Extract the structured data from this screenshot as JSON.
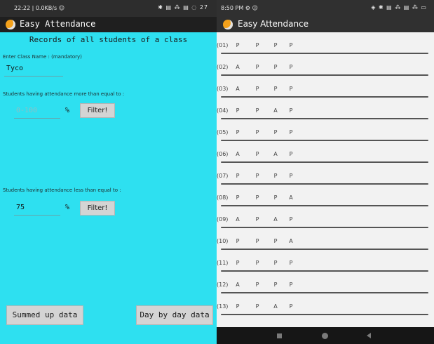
{
  "left": {
    "status": {
      "time": "22:22 | 0.0KB/s ☺",
      "icons": "✱ ▤ ⁂ ▤ ◌ 27"
    },
    "app_title": "Easy Attendance",
    "header": "Records of all students of a class",
    "class_label": "Enter Class Name : (mandatory)",
    "class_value": "Tyco",
    "more_label": "Students having attendance more than equal to :",
    "more_placeholder": "0-100",
    "percent": "%",
    "filter": "Filter!",
    "less_label": "Students having attendance less than equal to :",
    "less_value": "75",
    "summed_button": "Summed up data",
    "daybyday_button": "Day by day data"
  },
  "right": {
    "status": {
      "time": "8:50 PM ⚙ ☺",
      "icons": "◈ ✱ ▤ ⁂ ▤ ⁂ ▭"
    },
    "app_title": "Easy Attendance",
    "rows": [
      {
        "num": "(01)",
        "marks": [
          "P",
          "P",
          "P",
          "P"
        ]
      },
      {
        "num": "(02)",
        "marks": [
          "A",
          "P",
          "P",
          "P"
        ]
      },
      {
        "num": "(03)",
        "marks": [
          "A",
          "P",
          "P",
          "P"
        ]
      },
      {
        "num": "(04)",
        "marks": [
          "P",
          "P",
          "A",
          "P"
        ]
      },
      {
        "num": "(05)",
        "marks": [
          "P",
          "P",
          "P",
          "P"
        ]
      },
      {
        "num": "(06)",
        "marks": [
          "A",
          "P",
          "A",
          "P"
        ]
      },
      {
        "num": "(07)",
        "marks": [
          "P",
          "P",
          "P",
          "P"
        ]
      },
      {
        "num": "(08)",
        "marks": [
          "P",
          "P",
          "P",
          "A"
        ]
      },
      {
        "num": "(09)",
        "marks": [
          "A",
          "P",
          "A",
          "P"
        ]
      },
      {
        "num": "(10)",
        "marks": [
          "P",
          "P",
          "P",
          "A"
        ]
      },
      {
        "num": "(11)",
        "marks": [
          "P",
          "P",
          "P",
          "P"
        ]
      },
      {
        "num": "(12)",
        "marks": [
          "A",
          "P",
          "P",
          "P"
        ]
      },
      {
        "num": "(13)",
        "marks": [
          "P",
          "P",
          "A",
          "P"
        ]
      }
    ]
  }
}
